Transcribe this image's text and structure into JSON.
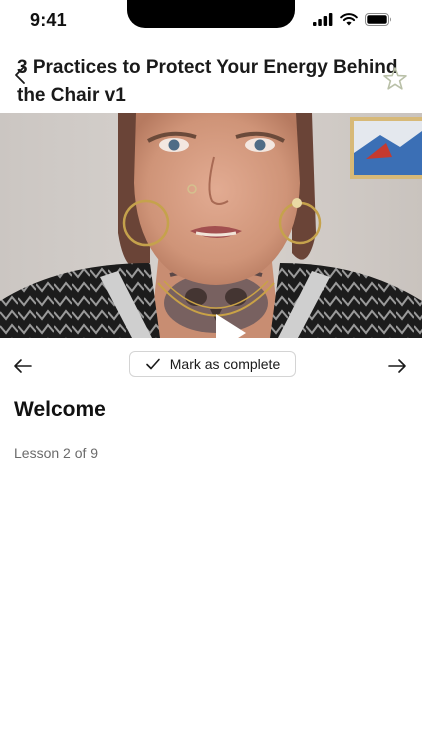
{
  "status_bar": {
    "time": "9:41",
    "icons": [
      "signal-icon",
      "wifi-icon",
      "battery-icon"
    ]
  },
  "header": {
    "title": "3 Practices to Protect Your Energy Behind the Chair v1",
    "back_icon": "chevron-left-icon",
    "favorite_icon": "star-outline-icon"
  },
  "video": {
    "play_icon": "play-icon"
  },
  "controls": {
    "prev_icon": "arrow-left-icon",
    "next_icon": "arrow-right-icon",
    "complete_label": "Mark as complete",
    "complete_icon": "check-icon"
  },
  "lesson": {
    "title": "Welcome",
    "progress": "Lesson 2 of 9"
  },
  "colors": {
    "star_outline": "#b9c0a8",
    "text_primary": "#111111",
    "text_secondary": "#6b6b6b",
    "button_border": "#d4d4d4"
  }
}
